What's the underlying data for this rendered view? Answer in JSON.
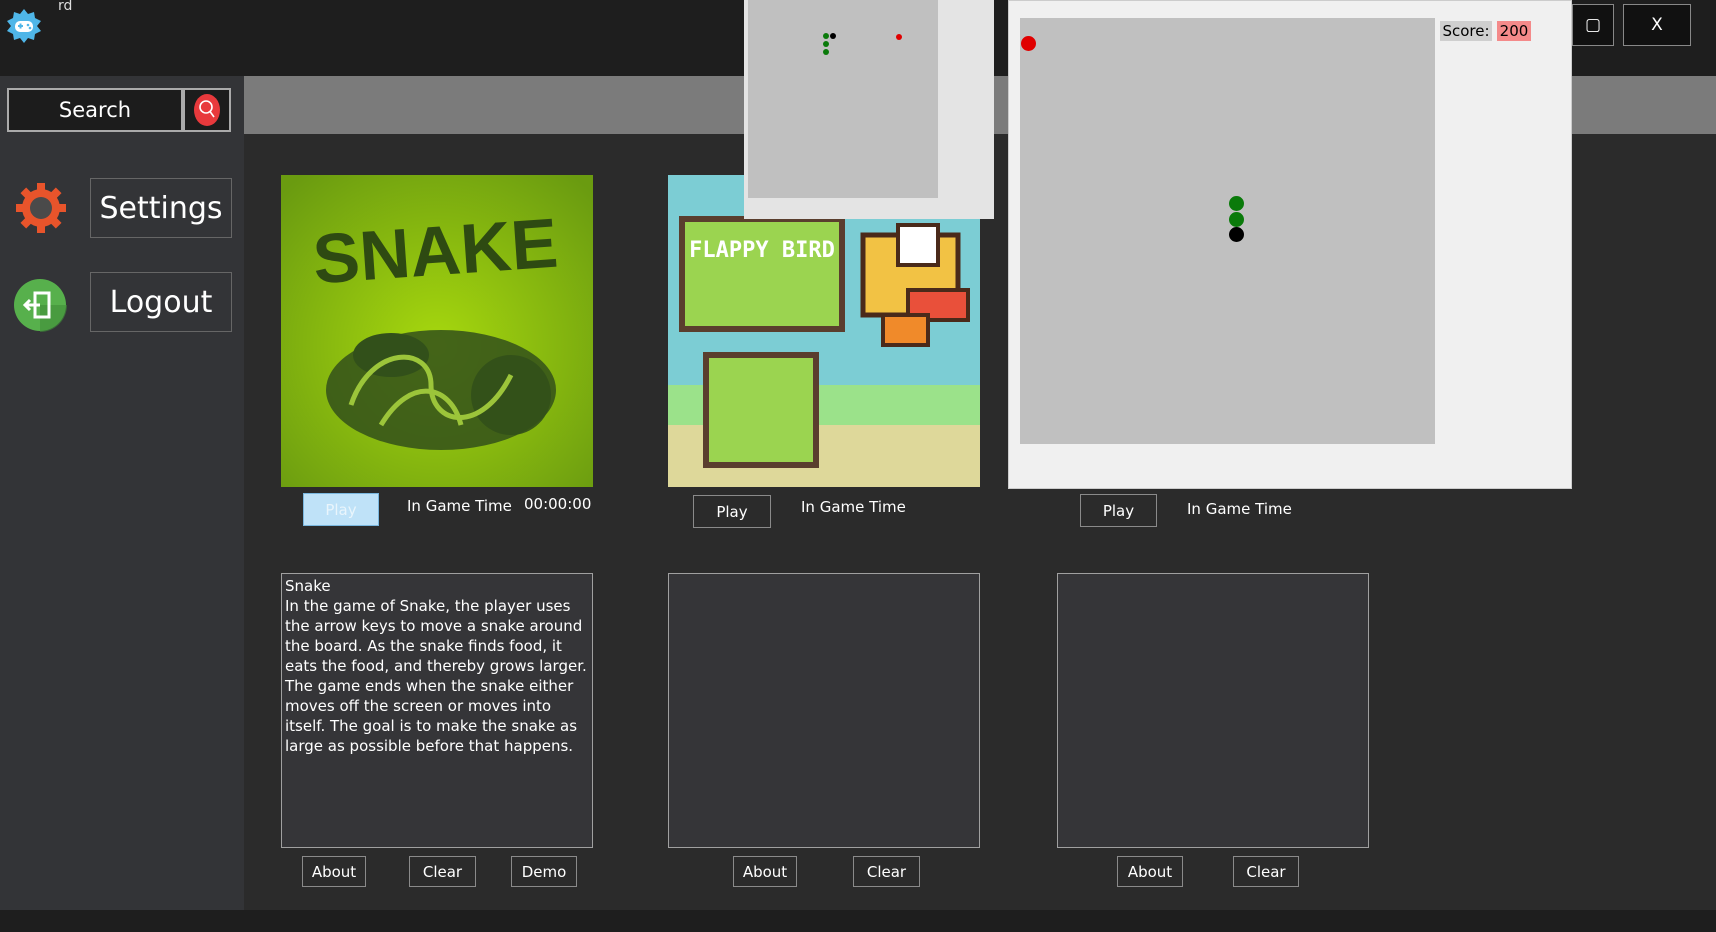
{
  "window": {
    "title": "rd",
    "controls": {
      "close": "X",
      "restore": "▢"
    }
  },
  "sidebar": {
    "search": {
      "label": "Search"
    },
    "settings": {
      "label": "Settings"
    },
    "logout": {
      "label": "Logout"
    }
  },
  "colors": {
    "accent_search": "#e8393c",
    "settings_icon": "#e8542b",
    "logout_icon": "#57b04c",
    "play_active": "#bfe2f8"
  },
  "games": [
    {
      "cover_title": "SNAKE",
      "play_label": "Play",
      "time_label": "In Game Time",
      "time_value": "00:00:00",
      "description_title": "Snake",
      "description": "In the game of Snake, the player uses the arrow keys to move a snake around the board. As the snake finds food, it eats the food, and thereby grows larger. The game ends when the snake either moves off the screen or moves into itself. The goal is to make the snake as large as possible before that happens.",
      "buttons": {
        "about": "About",
        "clear": "Clear",
        "demo": "Demo"
      }
    },
    {
      "cover_title": "FLAPPY BIRD",
      "play_label": "Play",
      "time_label": "In Game Time",
      "description": "",
      "buttons": {
        "about": "About",
        "clear": "Clear"
      }
    },
    {
      "play_label": "Play",
      "time_label": "In Game Time",
      "description": "",
      "buttons": {
        "about": "About",
        "clear": "Clear"
      }
    }
  ],
  "snake_window": {
    "score_label": "Score:",
    "score_value": "200"
  }
}
